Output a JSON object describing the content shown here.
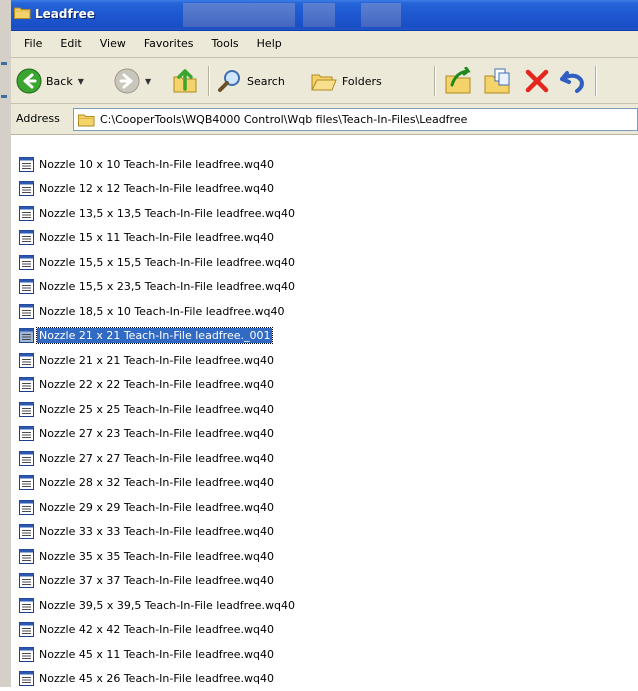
{
  "window": {
    "title": "Leadfree"
  },
  "menu": [
    {
      "label": "File"
    },
    {
      "label": "Edit"
    },
    {
      "label": "View"
    },
    {
      "label": "Favorites"
    },
    {
      "label": "Tools"
    },
    {
      "label": "Help"
    }
  ],
  "toolbar": {
    "back_label": "Back",
    "search_label": "Search",
    "folders_label": "Folders"
  },
  "address": {
    "label": "Address",
    "path": "C:\\CooperTools\\WQB4000 Control\\Wqb files\\Teach-In-Files\\Leadfree"
  },
  "files": [
    {
      "name": "Nozzle 10 x 10 Teach-In-File leadfree.wq40"
    },
    {
      "name": "Nozzle 12 x 12 Teach-In-File leadfree.wq40"
    },
    {
      "name": "Nozzle 13,5 x 13,5 Teach-In-File leadfree.wq40"
    },
    {
      "name": "Nozzle 15 x 11 Teach-In-File leadfree.wq40"
    },
    {
      "name": "Nozzle 15,5 x 15,5 Teach-In-File leadfree.wq40"
    },
    {
      "name": "Nozzle 15,5 x 23,5 Teach-In-File leadfree.wq40"
    },
    {
      "name": "Nozzle 18,5 x 10 Teach-In-File leadfree.wq40"
    },
    {
      "name": "Nozzle 21 x 21 Teach-In-File leadfree._001",
      "selected": true
    },
    {
      "name": "Nozzle 21 x 21 Teach-In-File leadfree.wq40"
    },
    {
      "name": "Nozzle 22 x 22 Teach-In-File leadfree.wq40"
    },
    {
      "name": "Nozzle 25 x 25 Teach-In-File leadfree.wq40"
    },
    {
      "name": "Nozzle 27 x 23 Teach-In-File leadfree.wq40"
    },
    {
      "name": "Nozzle 27 x 27 Teach-In-File leadfree.wq40"
    },
    {
      "name": "Nozzle 28 x 32 Teach-In-File leadfree.wq40"
    },
    {
      "name": "Nozzle 29 x 29 Teach-In-File leadfree.wq40"
    },
    {
      "name": "Nozzle 33 x 33 Teach-In-File leadfree.wq40"
    },
    {
      "name": "Nozzle 35 x 35 Teach-In-File leadfree.wq40"
    },
    {
      "name": "Nozzle 37 x 37 Teach-In-File leadfree.wq40"
    },
    {
      "name": "Nozzle 39,5 x 39,5 Teach-In-File leadfree.wq40"
    },
    {
      "name": "Nozzle 42 x 42 Teach-In-File leadfree.wq40"
    },
    {
      "name": "Nozzle 45 x 11 Teach-In-File leadfree.wq40"
    },
    {
      "name": "Nozzle 45 x 26 Teach-In-File leadfree.wq40"
    }
  ],
  "colors": {
    "titlebar": "#1d56cf",
    "chrome": "#ece9d8",
    "selection": "#316ac5"
  }
}
